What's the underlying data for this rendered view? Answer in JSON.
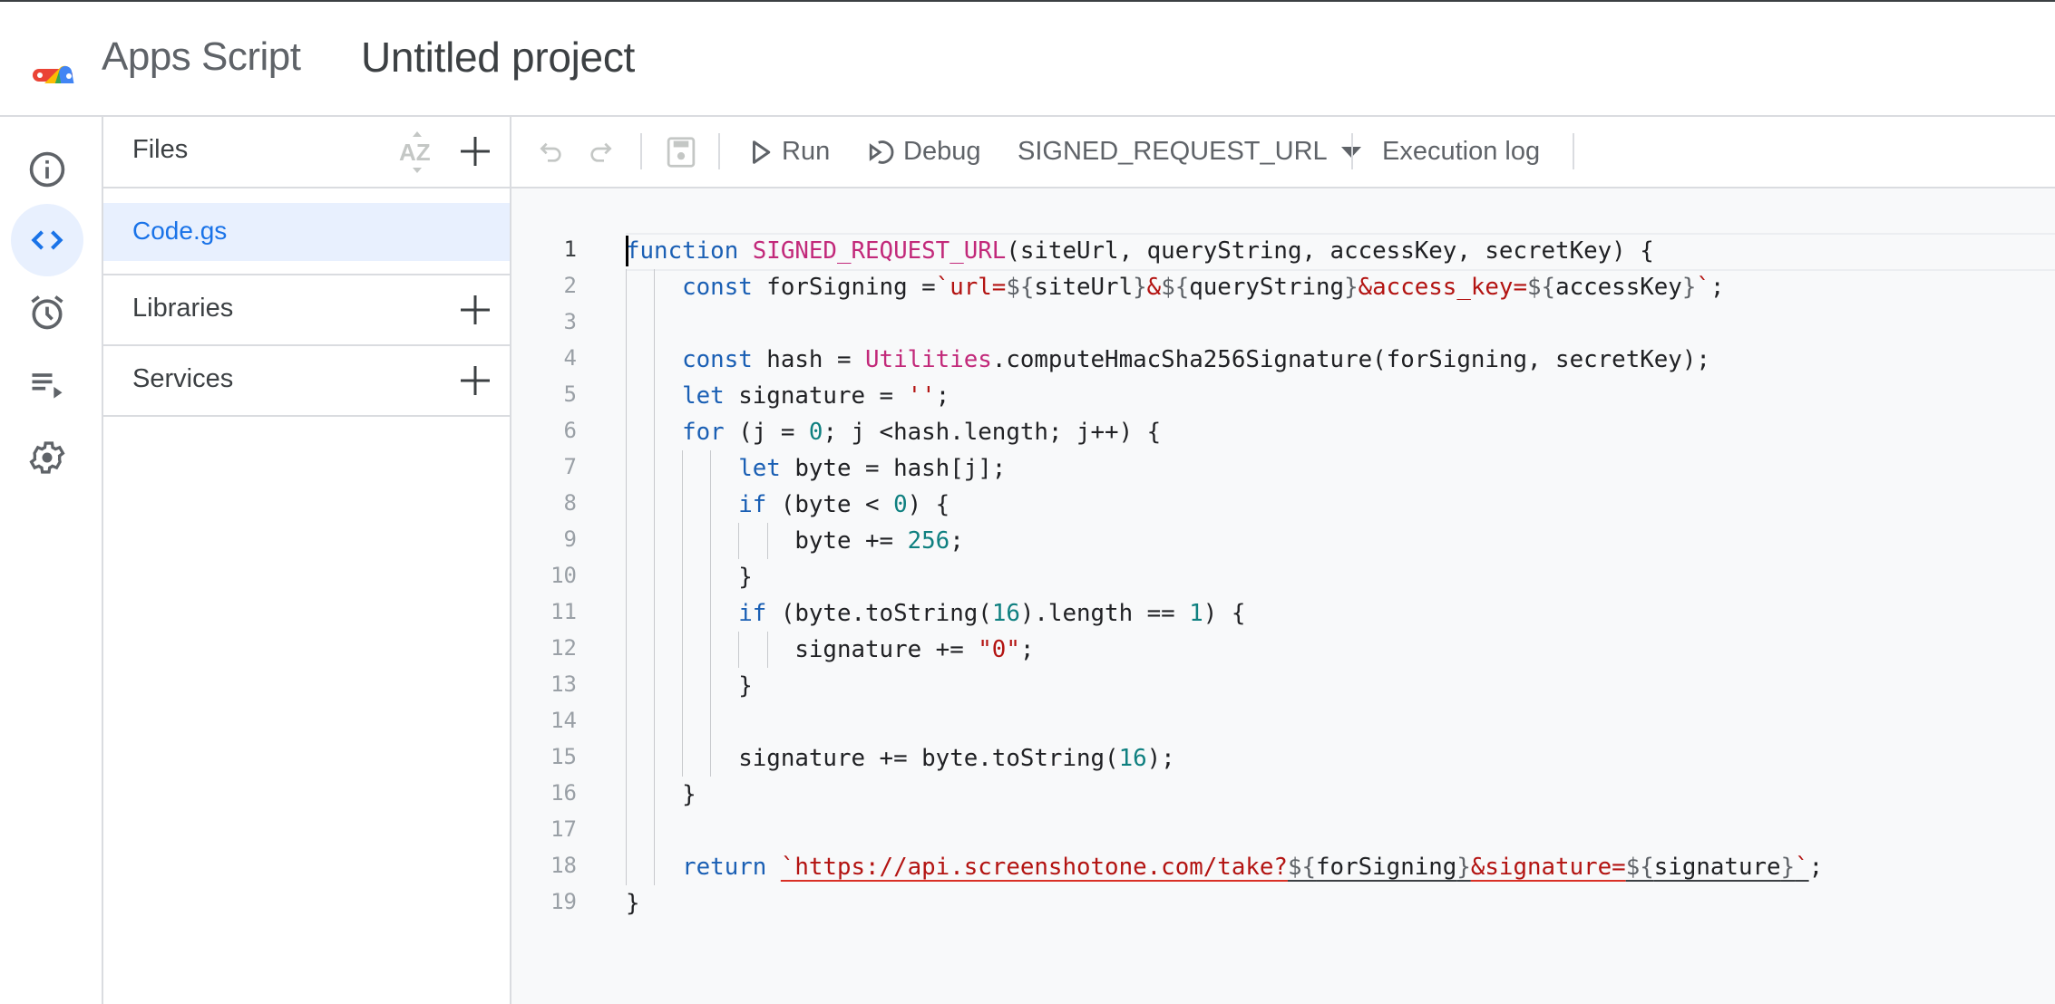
{
  "header": {
    "brand": "Apps Script",
    "project_title": "Untitled project"
  },
  "rail": {
    "items": [
      {
        "id": "overview",
        "icon": "info-icon",
        "active": false
      },
      {
        "id": "editor",
        "icon": "code-icon",
        "active": true
      },
      {
        "id": "triggers",
        "icon": "alarm-clock-icon",
        "active": false
      },
      {
        "id": "executions",
        "icon": "executions-icon",
        "active": false
      },
      {
        "id": "settings",
        "icon": "gear-icon",
        "active": false
      }
    ]
  },
  "panel": {
    "files_label": "Files",
    "files": [
      {
        "name": "Code.gs",
        "selected": true
      }
    ],
    "libraries_label": "Libraries",
    "services_label": "Services"
  },
  "toolbar": {
    "run_label": "Run",
    "debug_label": "Debug",
    "function_select": "SIGNED_REQUEST_URL",
    "execution_log_label": "Execution log"
  },
  "editor": {
    "current_line": 1,
    "lines": [
      [
        [
          "kw",
          "function"
        ],
        [
          "",
          " "
        ],
        [
          "fn",
          "SIGNED_REQUEST_URL"
        ],
        [
          "",
          "(siteUrl, queryString, accessKey, secretKey) {"
        ]
      ],
      [
        [
          "",
          "    "
        ],
        [
          "kw",
          "const"
        ],
        [
          "",
          " forSigning ="
        ],
        [
          "str",
          "`url="
        ],
        [
          "tpl",
          "${"
        ],
        [
          "",
          "siteUrl"
        ],
        [
          "tpl",
          "}"
        ],
        [
          "str",
          "&"
        ],
        [
          "tpl",
          "${"
        ],
        [
          "",
          "queryString"
        ],
        [
          "tpl",
          "}"
        ],
        [
          "str",
          "&access_key="
        ],
        [
          "tpl",
          "${"
        ],
        [
          "",
          "accessKey"
        ],
        [
          "tpl",
          "}"
        ],
        [
          "str",
          "`"
        ],
        [
          "",
          ";"
        ]
      ],
      [
        [
          "",
          ""
        ]
      ],
      [
        [
          "",
          "    "
        ],
        [
          "kw",
          "const"
        ],
        [
          "",
          " hash = "
        ],
        [
          "fn",
          "Utilities"
        ],
        [
          "",
          ".computeHmacSha256Signature(forSigning, secretKey);"
        ]
      ],
      [
        [
          "",
          "    "
        ],
        [
          "kw",
          "let"
        ],
        [
          "",
          " signature = "
        ],
        [
          "str",
          "''"
        ],
        [
          "",
          ";"
        ]
      ],
      [
        [
          "",
          "    "
        ],
        [
          "kw",
          "for"
        ],
        [
          "",
          " (j = "
        ],
        [
          "num",
          "0"
        ],
        [
          "",
          "; j <hash.length; j++) {"
        ]
      ],
      [
        [
          "",
          "        "
        ],
        [
          "kw",
          "let"
        ],
        [
          "",
          " byte = hash[j];"
        ]
      ],
      [
        [
          "",
          "        "
        ],
        [
          "kw",
          "if"
        ],
        [
          "",
          " (byte < "
        ],
        [
          "num",
          "0"
        ],
        [
          "",
          ") {"
        ]
      ],
      [
        [
          "",
          "            byte += "
        ],
        [
          "num",
          "256"
        ],
        [
          "",
          ";"
        ]
      ],
      [
        [
          "",
          "        }"
        ]
      ],
      [
        [
          "",
          "        "
        ],
        [
          "kw",
          "if"
        ],
        [
          "",
          " (byte.toString("
        ],
        [
          "num",
          "16"
        ],
        [
          "",
          ").length == "
        ],
        [
          "num",
          "1"
        ],
        [
          "",
          ") {"
        ]
      ],
      [
        [
          "",
          "            signature += "
        ],
        [
          "str",
          "\"0\""
        ],
        [
          "",
          ";"
        ]
      ],
      [
        [
          "",
          "        }"
        ]
      ],
      [
        [
          "",
          ""
        ]
      ],
      [
        [
          "",
          "        signature += byte.toString("
        ],
        [
          "num",
          "16"
        ],
        [
          "",
          ");"
        ]
      ],
      [
        [
          "",
          "    }"
        ]
      ],
      [
        [
          "",
          ""
        ]
      ],
      [
        [
          "",
          "    "
        ],
        [
          "kw",
          "return"
        ],
        [
          "",
          " "
        ],
        [
          "str squiggle-red",
          "`https://api.screenshotone.com/take?"
        ],
        [
          "tpl squiggle-dark",
          "${"
        ],
        [
          "squiggle-dark",
          "forSigning"
        ],
        [
          "tpl squiggle-dark",
          "}"
        ],
        [
          "str squiggle-red",
          "&signature="
        ],
        [
          "tpl squiggle-dark",
          "${"
        ],
        [
          "squiggle-dark",
          "signature"
        ],
        [
          "tpl squiggle-dark",
          "}"
        ],
        [
          "str squiggle-dark",
          "`"
        ],
        [
          "",
          ";"
        ]
      ],
      [
        [
          "",
          "}"
        ]
      ]
    ]
  },
  "colors": {
    "accent": "#1a73e8",
    "keyword": "#1a5fb4",
    "function_name": "#c2297a",
    "string": "#b31412",
    "number": "#0f8080"
  }
}
